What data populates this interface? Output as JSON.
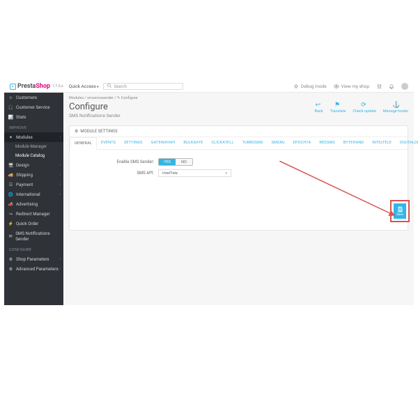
{
  "logo": {
    "brand_a": "Presta",
    "brand_b": "Shop",
    "version": "1.7.5.x"
  },
  "topbar": {
    "quick_access": "Quick Access",
    "search_placeholder": "Search",
    "search_icon": "Q",
    "right": {
      "debug": "Debug mode",
      "view_shop": "View my shop",
      "cart": "",
      "notifications": "",
      "avatar": ""
    }
  },
  "sidebar": {
    "top_items": [
      {
        "icon": "☺",
        "label": "Customers"
      },
      {
        "icon": "🎧",
        "label": "Customer Service"
      },
      {
        "icon": "📊",
        "label": "Stats"
      }
    ],
    "sections": [
      {
        "title": "IMPROVE",
        "items": [
          {
            "icon": "✦",
            "label": "Modules",
            "active": true,
            "expandable": true,
            "sub": [
              {
                "label": "Module Manager",
                "active": false
              },
              {
                "label": "Module Catalog",
                "active": true
              }
            ]
          },
          {
            "icon": "🖥",
            "label": "Design",
            "expandable": true
          },
          {
            "icon": "🚚",
            "label": "Shipping",
            "expandable": true
          },
          {
            "icon": "☳",
            "label": "Payment",
            "expandable": true
          },
          {
            "icon": "🌐",
            "label": "International",
            "expandable": true
          },
          {
            "icon": "📣",
            "label": "Advertising"
          },
          {
            "icon": "↪",
            "label": "Redirect Manager"
          },
          {
            "icon": "⚡",
            "label": "Quick Order"
          },
          {
            "icon": "✉",
            "label": "SMS Notifications Sender"
          }
        ]
      },
      {
        "title": "CONFIGURE",
        "items": [
          {
            "icon": "⚙",
            "label": "Shop Parameters",
            "expandable": true
          },
          {
            "icon": "⚙",
            "label": "Advanced Parameters",
            "expandable": true
          }
        ]
      }
    ]
  },
  "breadcrumb": "Modules / smssmssender / ✎ Configure",
  "page": {
    "title": "Configure",
    "subtitle": "SMS Notifications Sender"
  },
  "head_actions": {
    "back": "Back",
    "translate": "Translate",
    "check": "Check update",
    "hooks": "Manage hooks"
  },
  "panel": {
    "title": "MODULE SETTINGS",
    "tabs": [
      "GENERAL",
      "EVENTS",
      "SETTINGS",
      "GATEWAYAPI",
      "BULKGATE",
      "CLICKATELL",
      "TURBOSMS",
      "SMSRU",
      "EPOCHTA",
      "REDSMS",
      "BYTEHAND",
      "INTELTELE",
      "DIGITALDIRECT"
    ],
    "active_tab": "GENERAL",
    "form": {
      "enable_label": "Enable SMS Sender:",
      "toggle_yes": "YES",
      "toggle_no": "NO",
      "api_label": "SMS API:",
      "api_value": "IntelTele"
    },
    "save_label": "Save"
  }
}
